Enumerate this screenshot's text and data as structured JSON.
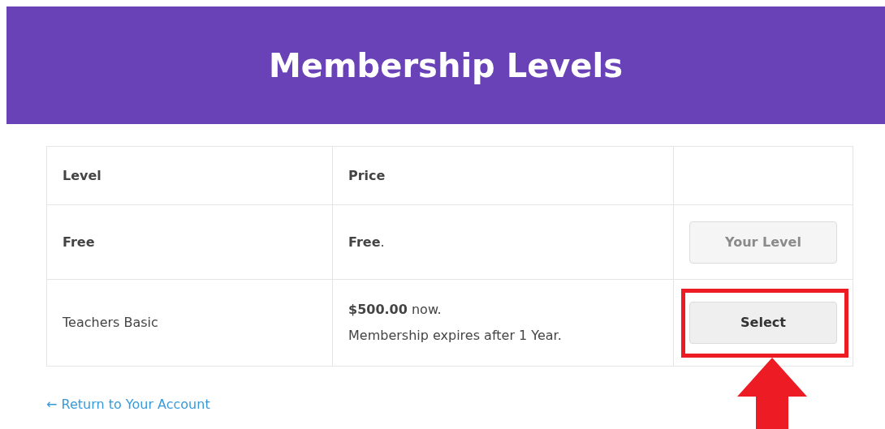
{
  "header": {
    "title": "Membership Levels"
  },
  "table": {
    "columns": [
      "Level",
      "Price",
      ""
    ],
    "rows": [
      {
        "level": "Free",
        "current": true,
        "price": "**Free**.",
        "note": null,
        "button": {
          "label": "Your Level",
          "disabled": true
        },
        "highlighted": false
      },
      {
        "level": "Teachers Basic",
        "current": false,
        "price": "**$500.00** now.",
        "note": "Membership expires after 1 Year.",
        "button": {
          "label": "Select",
          "disabled": false
        },
        "highlighted": true
      }
    ]
  },
  "return_link": "← Return to Your Account"
}
